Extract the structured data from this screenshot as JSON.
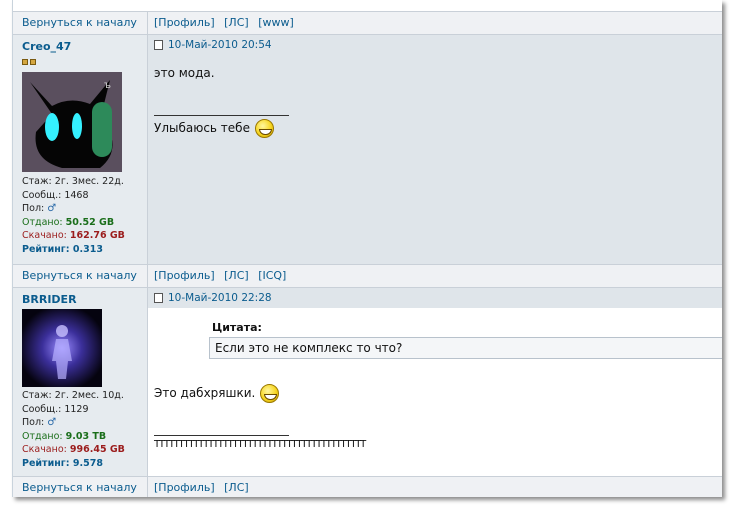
{
  "colors": {
    "link": "#0b5c8e",
    "uploaded": "#1a6e1a",
    "downloaded": "#9b1c1c",
    "post_bg": "#dfe5ea",
    "separator_bg": "#eff1f4"
  },
  "nav": {
    "back_to_top": "Вернуться к началу"
  },
  "sep1": {
    "links": [
      "[Профиль]",
      "[ЛС]",
      "[www]"
    ]
  },
  "sep2": {
    "links": [
      "[Профиль]",
      "[ЛС]",
      "[ICQ]"
    ]
  },
  "sep3": {
    "links": [
      "[Профиль]",
      "[ЛС]"
    ]
  },
  "posts": [
    {
      "author": "Creo_47",
      "rank_stars": 2,
      "stats": {
        "tenure_label": "Стаж:",
        "tenure": "2г. 3мес. 22д.",
        "posts_label": "Сообщ.:",
        "posts": "1468",
        "gender_label": "Пол:",
        "gender_icon": "male-icon",
        "uploaded_label": "Отдано:",
        "uploaded": "50.52 GB",
        "downloaded_label": "Скачано:",
        "downloaded": "162.76 GB",
        "rating_label": "Рейтинг:",
        "rating": "0.313"
      },
      "date": "10-Май-2010 20:54",
      "text": "это мода.",
      "signature": "Улыбаюсь тебе"
    },
    {
      "author": "BRRIDER",
      "stats": {
        "tenure_label": "Стаж:",
        "tenure": "2г. 2мес. 10д.",
        "posts_label": "Сообщ.:",
        "posts": "1129",
        "gender_label": "Пол:",
        "gender_icon": "male-icon",
        "uploaded_label": "Отдано:",
        "uploaded": "9.03 TB",
        "downloaded_label": "Скачано:",
        "downloaded": "996.45 GB",
        "rating_label": "Рейтинг:",
        "rating": "9.578"
      },
      "date": "10-Май-2010 22:28",
      "quote_title": "Цитата:",
      "quote_text": "Если это не комплекс то что?",
      "text": "Это дабхряшки.",
      "signature": "ТТТТТТТТТТТТТТТТТТТТТТТТТТТТТТТТТТТТТТТТТТТ"
    }
  ]
}
